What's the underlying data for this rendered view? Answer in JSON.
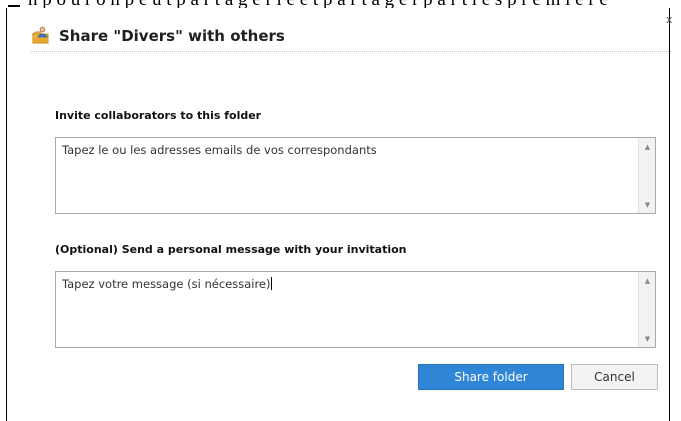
{
  "background": {
    "cut_text": "n p o u r    o n p e u t p a r t a g e r l e     e t p a r t a g e r     p a r t i e s   p r e m i è r e"
  },
  "dialog": {
    "title": "Share \"Divers\" with others",
    "close_label": "x",
    "invite": {
      "label": "Invite collaborators to this folder",
      "value": "Tapez le ou les adresses emails de vos correspondants"
    },
    "message": {
      "label": "(Optional) Send a personal message with your invitation",
      "value": "Tapez votre message (si nécessaire)"
    },
    "buttons": {
      "share_label": "Share folder",
      "cancel_label": "Cancel"
    }
  },
  "icons": {
    "title_icon": "shared-folder-icon",
    "scroll_up": "scroll-up-arrow-icon",
    "scroll_down": "scroll-down-arrow-icon"
  },
  "colors": {
    "primary_button": "#2f86d6",
    "secondary_button": "#f3f3f3",
    "textarea_border": "#a9a9a9"
  }
}
